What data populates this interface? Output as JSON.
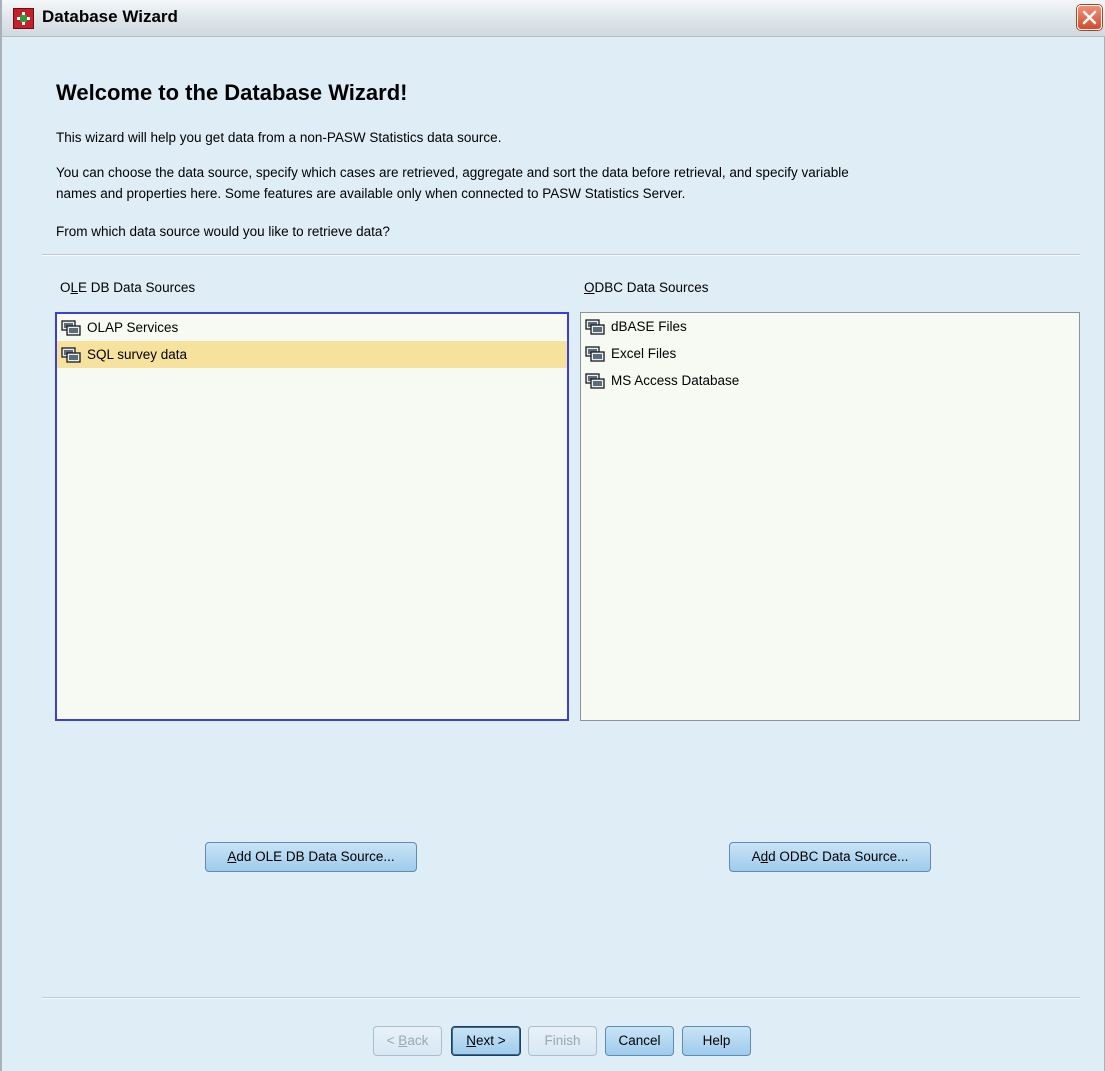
{
  "window": {
    "title": "Database Wizard"
  },
  "content": {
    "heading": "Welcome to the Database Wizard!",
    "intro": "This wizard will help you get data from a non-PASW Statistics data source.",
    "description_line1": "You can choose the data source, specify which cases are retrieved, aggregate and sort the data before retrieval, and specify variable",
    "description_line2": "names and properties here. Some features are available only when connected to PASW Statistics Server.",
    "question": "From which data source would you like to retrieve data?"
  },
  "oledb": {
    "label_pre": "O",
    "label_mnemonic": "L",
    "label_post": "E DB Data Sources",
    "items": [
      {
        "label": "OLAP Services",
        "icon": "database-icon",
        "selected": false
      },
      {
        "label": "SQL survey data",
        "icon": "database-icon",
        "selected": true
      }
    ],
    "add_button_mnemonic": "A",
    "add_button_rest": "dd OLE DB Data Source..."
  },
  "odbc": {
    "label_mnemonic": "O",
    "label_post": "DBC Data Sources",
    "items": [
      {
        "label": "dBASE Files",
        "icon": "database-icon"
      },
      {
        "label": "Excel Files",
        "icon": "database-icon"
      },
      {
        "label": "MS Access Database",
        "icon": "database-icon"
      }
    ],
    "add_button_pre": "A",
    "add_button_mnemonic": "d",
    "add_button_rest": "d ODBC Data Source..."
  },
  "footer": {
    "back_pre": "< ",
    "back_mnemonic": "B",
    "back_rest": "ack",
    "next_mnemonic": "N",
    "next_rest": "ext >",
    "finish": "Finish",
    "cancel": "Cancel",
    "help": "Help"
  },
  "colors": {
    "window_bg": "#dfeef6",
    "list_bg": "#f6faf3",
    "selection": "#f7e29d",
    "focus_border": "#3b3fd6",
    "close_button": "#d54a2c"
  }
}
